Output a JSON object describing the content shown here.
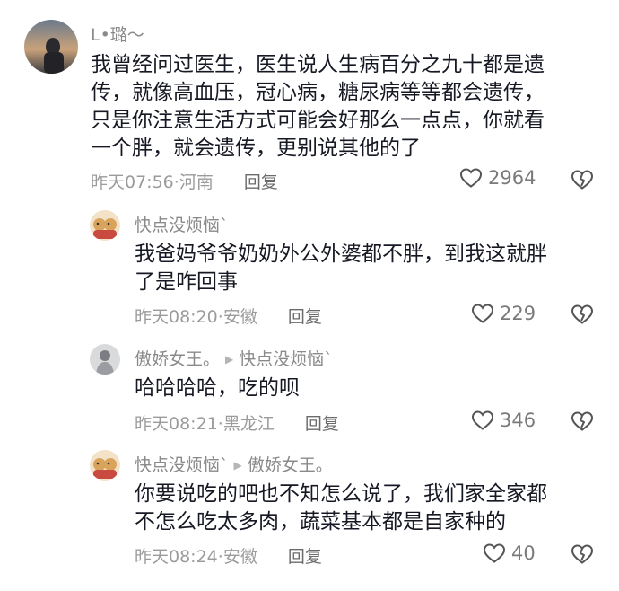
{
  "comments": [
    {
      "user": "L•璐～",
      "text_lines": [
        "我曾经问过医生，医生说人生病百分之九十都是遗",
        "传，就像高血压，冠心病，糖尿病等等都会遗传，",
        "只是你注意生活方式可能会好那么一点点，你就看",
        "一个胖，就会遗传，更别说其他的了"
      ],
      "time": "昨天07:56",
      "location": "河南",
      "reply_label": "回复",
      "likes": "2964"
    },
    {
      "user": "快点没烦恼`",
      "text_lines": [
        "我爸妈爷爷奶奶外公外婆都不胖，到我这就胖",
        "了是咋回事"
      ],
      "time": "昨天08:20",
      "location": "安徽",
      "reply_label": "回复",
      "likes": "229"
    },
    {
      "user": "傲娇女王。",
      "reply_to": "快点没烦恼`",
      "text_lines": [
        "哈哈哈哈，吃的呗"
      ],
      "time": "昨天08:21",
      "location": "黑龙江",
      "reply_label": "回复",
      "likes": "346"
    },
    {
      "user": "快点没烦恼`",
      "reply_to": "傲娇女王。",
      "text_lines": [
        "你要说吃的吧也不知怎么说了，我们家全家都",
        "不怎么吃太多肉，蔬菜基本都是自家种的"
      ],
      "time": "昨天08:24",
      "location": "安徽",
      "reply_label": "回复",
      "likes": "40"
    }
  ],
  "colors": {
    "text": "#161823",
    "meta": "#9b9b9b",
    "username": "#8a8a8a"
  },
  "icons": {
    "like": "heart-outline-icon",
    "dislike": "broken-heart-icon",
    "reply_arrow": "triangle-right-icon"
  }
}
